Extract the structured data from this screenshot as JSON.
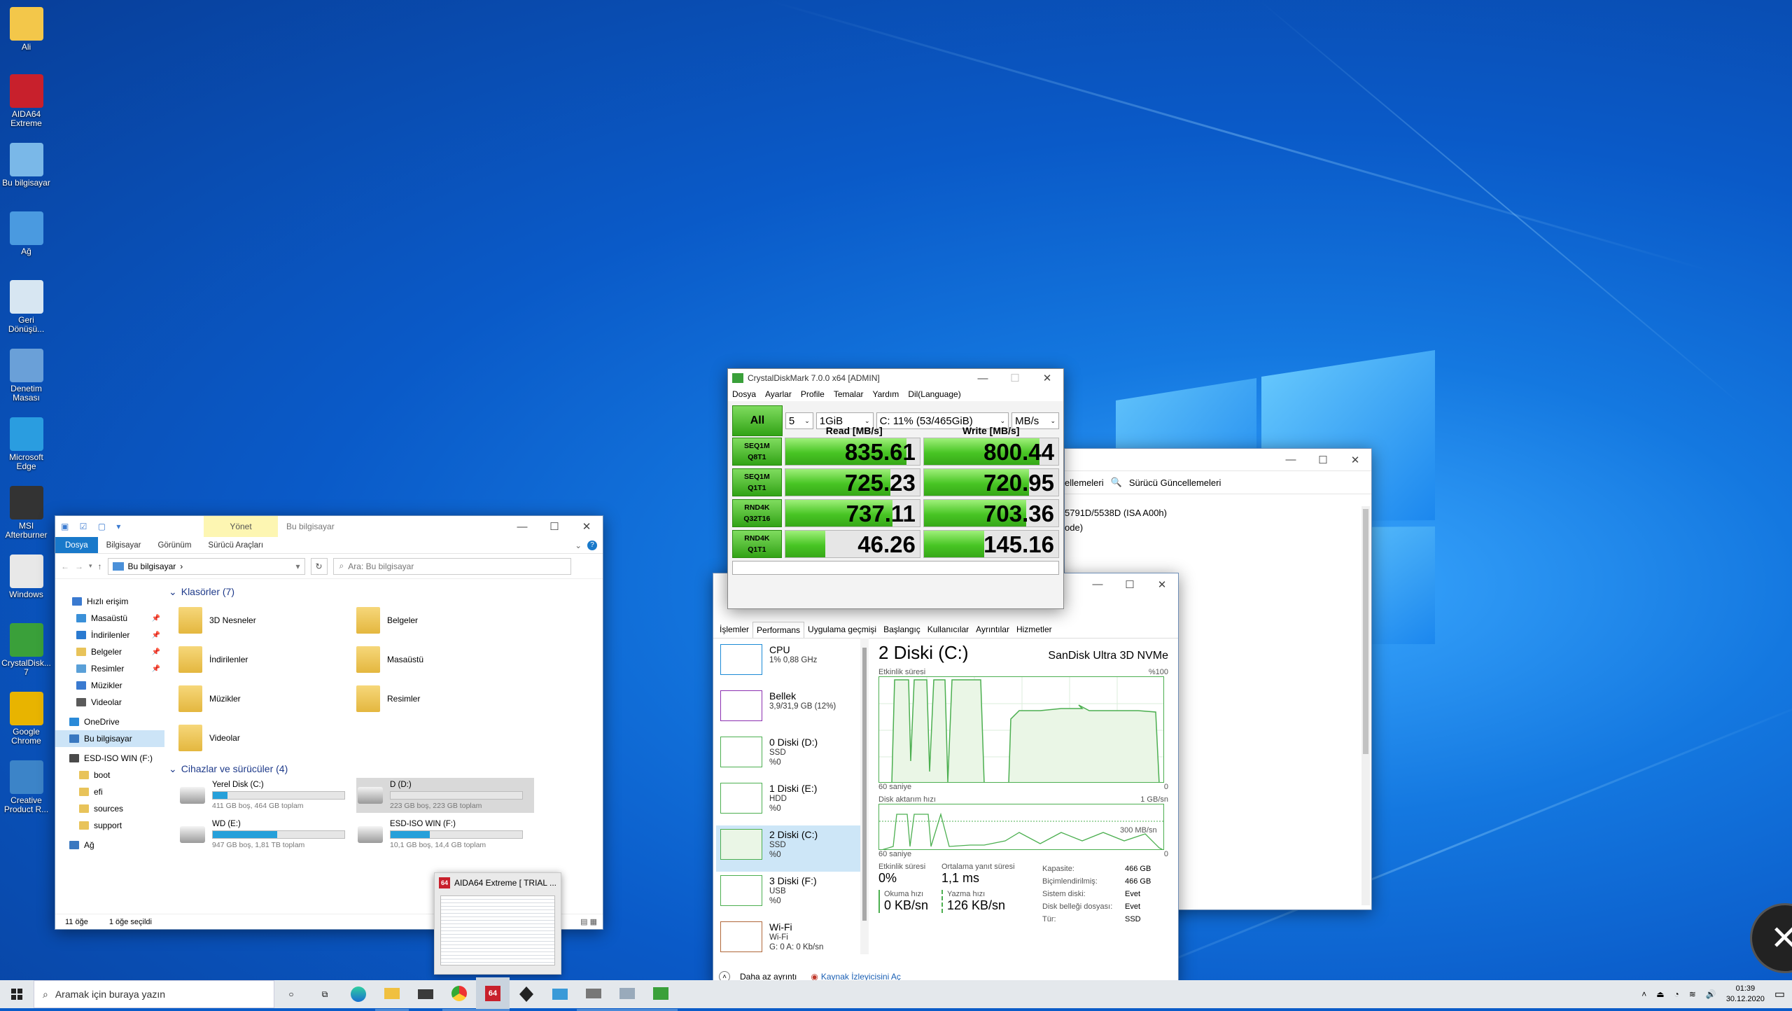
{
  "desktop_icons": [
    {
      "label": "Ali",
      "color": "#f3c74a"
    },
    {
      "label": "AIDA64 Extreme",
      "color": "#c8202c"
    },
    {
      "label": "Bu bilgisayar",
      "color": "#7ab8e8"
    },
    {
      "label": "Ağ",
      "color": "#4a9ae0"
    },
    {
      "label": "Geri Dönüşü...",
      "color": "#d7e6f2"
    },
    {
      "label": "Denetim Masası",
      "color": "#6aa0d8"
    },
    {
      "label": "Microsoft Edge",
      "color": "#2a9de0"
    },
    {
      "label": "MSI Afterburner",
      "color": "#333333"
    },
    {
      "label": "Windows",
      "color": "#e8e8e8"
    },
    {
      "label": "CrystalDisk... 7",
      "color": "#3aa03a"
    },
    {
      "label": "Google Chrome",
      "color": "#e8b400"
    },
    {
      "label": "Creative Product R...",
      "color": "#3c84c8"
    }
  ],
  "crystal": {
    "title": "CrystalDiskMark 7.0.0 x64 [ADMIN]",
    "menu": [
      "Dosya",
      "Ayarlar",
      "Profile",
      "Temalar",
      "Yardım",
      "Dil(Language)"
    ],
    "all_label": "All",
    "count": "5",
    "size": "1GiB",
    "drive": "C: 11% (53/465GiB)",
    "unit": "MB/s",
    "read_header": "Read [MB/s]",
    "write_header": "Write [MB/s]",
    "rows": [
      {
        "l1": "SEQ1M",
        "l2": "Q8T1",
        "read": "835.61",
        "write": "800.44",
        "rf": 0.9,
        "wf": 0.86
      },
      {
        "l1": "SEQ1M",
        "l2": "Q1T1",
        "read": "725.23",
        "write": "720.95",
        "rf": 0.78,
        "wf": 0.78
      },
      {
        "l1": "RND4K",
        "l2": "Q32T16",
        "read": "737.11",
        "write": "703.36",
        "rf": 0.8,
        "wf": 0.76
      },
      {
        "l1": "RND4K",
        "l2": "Q1T1",
        "read": "46.26",
        "write": "145.16",
        "rf": 0.3,
        "wf": 0.45
      }
    ]
  },
  "explorer": {
    "ribbon_manage": "Yönet",
    "title": "Bu bilgisayar",
    "tabs": [
      "Dosya",
      "Bilgisayar",
      "Görünüm",
      "Sürücü Araçları"
    ],
    "address": "Bu bilgisayar",
    "search_placeholder": "Ara: Bu bilgisayar",
    "nav": [
      "Hızlı erişim",
      "Masaüstü",
      "İndirilenler",
      "Belgeler",
      "Resimler",
      "Müzikler",
      "Videolar",
      "OneDrive",
      "Bu bilgisayar",
      "ESD-ISO WIN (F:)",
      "boot",
      "efi",
      "sources",
      "support",
      "Ağ"
    ],
    "folders_header": "Klasörler (7)",
    "folders": [
      "3D Nesneler",
      "Belgeler",
      "İndirilenler",
      "Masaüstü",
      "Müzikler",
      "Resimler",
      "Videolar"
    ],
    "devices_header": "Cihazlar ve sürücüler (4)",
    "drives": [
      {
        "name": "Yerel Disk (C:)",
        "info": "411 GB boş, 464 GB toplam",
        "fill": 0.11
      },
      {
        "name": "D (D:)",
        "info": "223 GB boş, 223 GB toplam",
        "fill": 0.0
      },
      {
        "name": "WD  (E:)",
        "info": "947 GB boş, 1,81 TB toplam",
        "fill": 0.49
      },
      {
        "name": "ESD-ISO WIN (F:)",
        "info": "10,1 GB boş, 14,4 GB toplam",
        "fill": 0.3
      }
    ],
    "status_items": "11 öğe",
    "status_selected": "1 öğe seçildi"
  },
  "devmgr": {
    "toolbar_text": "ellemeleri",
    "driver_updates": "Sürücü Güncellemeleri",
    "line1": "5791D/5538D  (ISA A00h)",
    "line2": "ode)"
  },
  "taskmgr": {
    "tabs": [
      "İşlemler",
      "Performans",
      "Uygulama geçmişi",
      "Başlangıç",
      "Kullanıcılar",
      "Ayrıntılar",
      "Hizmetler"
    ],
    "items": [
      {
        "name": "CPU",
        "s1": "1% 0,88 GHz",
        "s2": "",
        "s3": "",
        "color": "#1b8ad6"
      },
      {
        "name": "Bellek",
        "s1": "3,9/31,9 GB (12%)",
        "s2": "",
        "s3": "",
        "color": "#8b2fb0"
      },
      {
        "name": "0 Diski (D:)",
        "s1": "SSD",
        "s2": "%0",
        "s3": "",
        "color": "#4caf50"
      },
      {
        "name": "1 Diski (E:)",
        "s1": "HDD",
        "s2": "%0",
        "s3": "",
        "color": "#4caf50"
      },
      {
        "name": "2 Diski (C:)",
        "s1": "SSD",
        "s2": "%0",
        "s3": "",
        "color": "#4caf50"
      },
      {
        "name": "3 Diski (F:)",
        "s1": "USB",
        "s2": "%0",
        "s3": "",
        "color": "#4caf50"
      },
      {
        "name": "Wi-Fi",
        "s1": "Wi-Fi",
        "s2": "G: 0 A: 0 Kb/sn",
        "s3": "",
        "color": "#b0683a"
      }
    ],
    "disk_title": "2 Diski (C:)",
    "disk_model": "SanDisk Ultra 3D NVMe",
    "active_label": "Etkinlik süresi",
    "pct100": "%100",
    "sec60": "60 saniye",
    "zero": "0",
    "rate_label": "Disk aktarım hızı",
    "gb1": "1 GB/sn",
    "mb300": "300 MB/sn",
    "stats": {
      "active_l": "Etkinlik süresi",
      "active_v": "0%",
      "resp_l": "Ortalama yanıt süresi",
      "resp_v": "1,1 ms",
      "read_l": "Okuma hızı",
      "read_v": "0 KB/sn",
      "write_l": "Yazma hızı",
      "write_v": "126 KB/sn"
    },
    "props": [
      [
        "Kapasite:",
        "466 GB"
      ],
      [
        "Biçimlendirilmiş:",
        "466 GB"
      ],
      [
        "Sistem diski:",
        "Evet"
      ],
      [
        "Disk belleği dosyası:",
        "Evet"
      ],
      [
        "Tür:",
        "SSD"
      ]
    ],
    "less": "Daha az ayrıntı",
    "monitor": "Kaynak İzleyicisini Aç"
  },
  "aida_thumb": {
    "title": "AIDA64 Extreme  [ TRIAL ..."
  },
  "taskbar": {
    "search_placeholder": "Aramak için buraya yazın",
    "time": "01:39",
    "date": "30.12.2020"
  }
}
